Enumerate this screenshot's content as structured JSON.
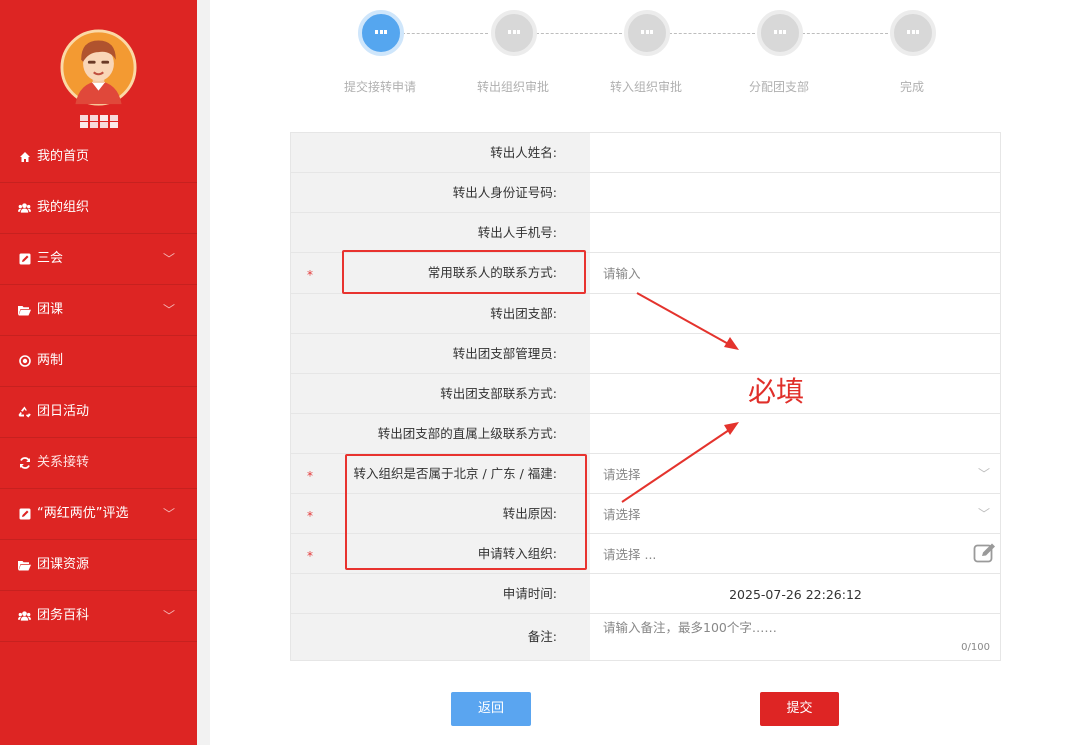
{
  "sidebar": {
    "username": "",
    "items": [
      {
        "label": "我的首页",
        "icon": "home-icon",
        "chevron": false
      },
      {
        "label": "我的组织",
        "icon": "users-icon",
        "chevron": false
      },
      {
        "label": "三会",
        "icon": "edit-square-icon",
        "chevron": true
      },
      {
        "label": "团课",
        "icon": "folder-open-icon",
        "chevron": true
      },
      {
        "label": "两制",
        "icon": "target-circle-icon",
        "chevron": false
      },
      {
        "label": "团日活动",
        "icon": "recycle-icon",
        "chevron": false
      },
      {
        "label": "关系接转",
        "icon": "refresh-icon",
        "chevron": false
      },
      {
        "label": "“两红两优”评选",
        "icon": "edit-square-icon",
        "chevron": true
      },
      {
        "label": "团课资源",
        "icon": "folder-open-icon",
        "chevron": false
      },
      {
        "label": "团务百科",
        "icon": "users-icon",
        "chevron": true
      }
    ],
    "chevron_glyph": "﹀"
  },
  "steps": [
    {
      "label": "提交接转申请",
      "active": true
    },
    {
      "label": "转出组织审批",
      "active": false
    },
    {
      "label": "转入组织审批",
      "active": false
    },
    {
      "label": "分配团支部",
      "active": false
    },
    {
      "label": "完成",
      "active": false
    }
  ],
  "form": {
    "out_name": {
      "label": "转出人姓名:"
    },
    "out_id": {
      "label": "转出人身份证号码:"
    },
    "out_phone": {
      "label": "转出人手机号:"
    },
    "contact": {
      "label": "常用联系人的联系方式:",
      "placeholder": "请输入",
      "required": "*"
    },
    "out_branch": {
      "label": "转出团支部:"
    },
    "out_branch_admin": {
      "label": "转出团支部管理员:"
    },
    "out_branch_contact": {
      "label": "转出团支部联系方式:"
    },
    "out_branch_superior": {
      "label": "转出团支部的直属上级联系方式:"
    },
    "region": {
      "label": "转入组织是否属于北京 / 广东 / 福建:",
      "placeholder": "请选择",
      "required": "*"
    },
    "reason": {
      "label": "转出原因:",
      "placeholder": "请选择",
      "required": "*"
    },
    "target_org": {
      "label": "申请转入组织:",
      "placeholder": "请选择 ...",
      "required": "*"
    },
    "apply_time": {
      "label": "申请时间:",
      "value": "2025-07-26 22:26:12"
    },
    "remark": {
      "label": "备注:",
      "placeholder": "请输入备注，最多100个字……",
      "counter": "0/100"
    },
    "select_arrow": "﹀"
  },
  "annotation": {
    "text": "必填"
  },
  "buttons": {
    "back": "返回",
    "submit": "提交"
  },
  "colors": {
    "sidebar": "#dd2523",
    "accent_blue": "#55a6ef",
    "submit_red": "#de2524",
    "annotation_red": "#e02f2a"
  }
}
